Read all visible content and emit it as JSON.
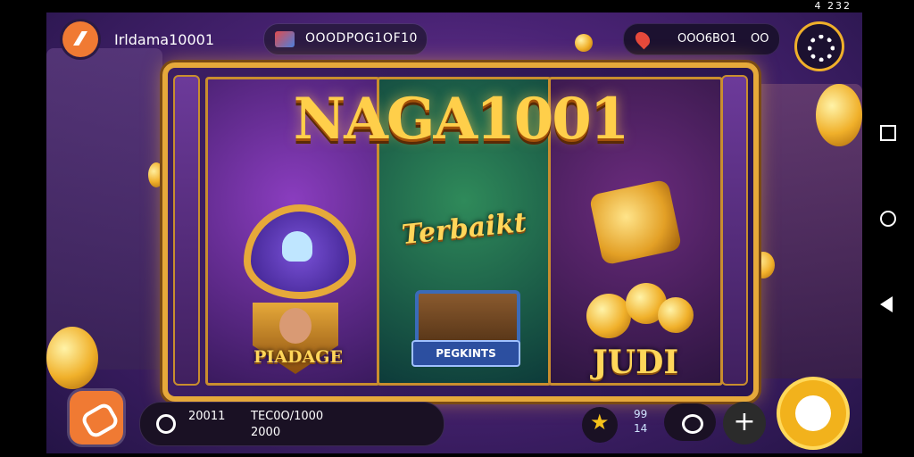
{
  "status": {
    "left_text": "",
    "right_text": "4 232"
  },
  "top": {
    "username": "Irldama10001",
    "balance": "ΟΟΟDPΟG1ΟF10",
    "prize_value": "ΟΟΟ6ΒΟ1",
    "prize_extra": "ΟΟ"
  },
  "board": {
    "title": "NAGA1001",
    "reel1_label": "PIADAGE",
    "reel2_label": "Terbaikt",
    "reel2_banner": "PEGKINTS",
    "reel3_label": "JUDI"
  },
  "bottom": {
    "bet_label": "20011",
    "bet_value_top": "TEC0Ο/1000",
    "bet_value_bottom": "2000",
    "line_info_top": "99",
    "line_info_bottom": "14"
  },
  "icons": [
    "app-logo-icon",
    "balance-icon",
    "location-pin-icon",
    "gear-icon",
    "key-icon",
    "star-icon",
    "cloud-icon",
    "plus-icon",
    "spin-icon"
  ],
  "colors": {
    "accent": "#f07a33",
    "gold": "#f2b21c",
    "bg": "#4a2375"
  }
}
